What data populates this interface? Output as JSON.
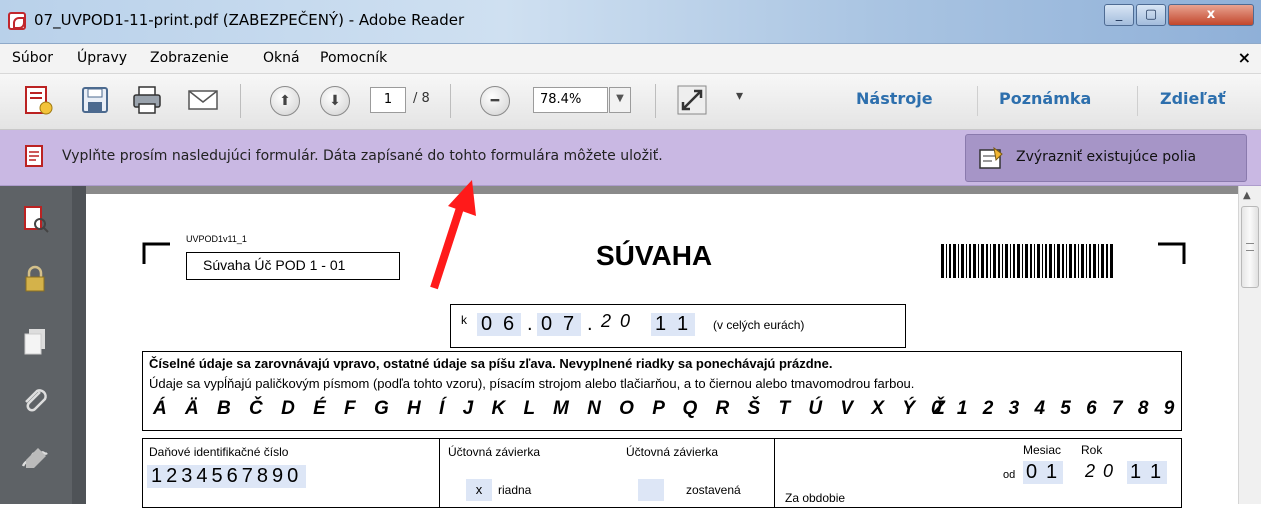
{
  "window": {
    "title": "07_UVPOD1-11-print.pdf (ZABEZPEČENÝ) - Adobe Reader",
    "controls": [
      "_",
      "▢",
      "x"
    ]
  },
  "menu": {
    "items": [
      "Súbor",
      "Úpravy",
      "Zobrazenie",
      "Okná",
      "Pomocník"
    ],
    "close": "×"
  },
  "toolbar": {
    "page_current": "1",
    "page_total": "/ 8",
    "zoom": "78.4%",
    "dropdown": "▾",
    "links": [
      "Nástroje",
      "Poznámka",
      "Zdieľať"
    ]
  },
  "notice": {
    "text": "Vyplňte prosím nasledujúci formulár. Dáta zapísané do tohto formulára môžete uložiť.",
    "button": "Zvýrazniť existujúce polia",
    "bg_color": "#c9b8e3"
  },
  "form": {
    "code": "UVPOD1v11_1",
    "form_name": "Súvaha Úč POD 1 - 01",
    "title": "SÚVAHA",
    "date_prefix": "k",
    "date_day": [
      "0",
      "6"
    ],
    "date_month": [
      "0",
      "7"
    ],
    "date_year_hand": [
      "2",
      "0"
    ],
    "date_year": [
      "1",
      "1"
    ],
    "date_suffix": "(v celých eurách)",
    "instr_bold": "Číselné údaje sa zarovnávajú vpravo, ostatné údaje sa píšu zľava. Nevyplnené riadky sa ponechávajú prázdne.",
    "instr_normal": "Údaje sa vypĺňajú paličkovým písmom (podľa tohto vzoru), písacím strojom alebo tlačiarňou, a to čiernou alebo tmavomodrou farbou.",
    "alphabet": [
      "Á",
      "Ä",
      "B",
      "Č",
      "D",
      "É",
      "F",
      "G",
      "H",
      "Í",
      "J",
      "K",
      "L",
      "M",
      "N",
      "O",
      "P",
      "Q",
      "R",
      "Š",
      "T",
      "Ú",
      "V",
      "X",
      "Ý",
      "Ž"
    ],
    "digits": [
      "0",
      "1",
      "2",
      "3",
      "4",
      "5",
      "6",
      "7",
      "8",
      "9"
    ],
    "dic_label": "Daňové identifikačné číslo",
    "dic_value": [
      "1",
      "2",
      "3",
      "4",
      "5",
      "6",
      "7",
      "8",
      "9",
      "0"
    ],
    "zav1_label": "Účtovná závierka",
    "zav2_label": "Účtovná závierka",
    "zav1_mark": "x",
    "zav1_option": "riadna",
    "zav2_option": "zostavená",
    "mesiac_label": "Mesiac",
    "rok_label": "Rok",
    "od_label": "od",
    "od_month": [
      "0",
      "1"
    ],
    "od_year_hand": [
      "2",
      "0"
    ],
    "od_year": [
      "1",
      "1"
    ],
    "obdobie_label": "Za obdobie"
  }
}
